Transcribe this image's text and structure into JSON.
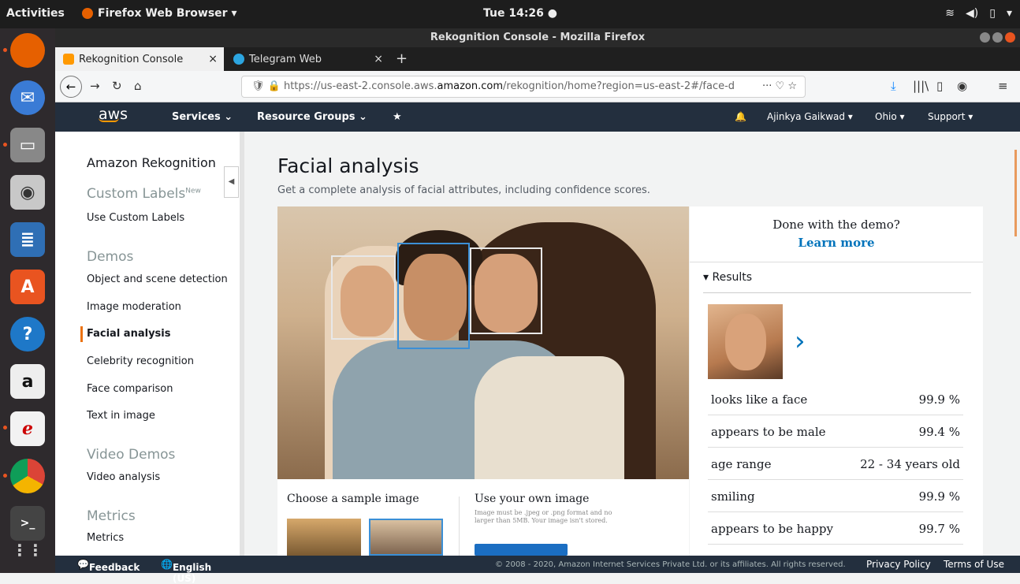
{
  "system": {
    "activities": "Activities",
    "app_menu": "Firefox Web Browser ▾",
    "clock": "Tue 14:26 ●"
  },
  "window": {
    "title": "Rekognition Console - Mozilla Firefox"
  },
  "tabs": [
    {
      "label": "Rekognition Console",
      "close": "×"
    },
    {
      "label": "Telegram Web",
      "close": "×"
    }
  ],
  "new_tab": "+",
  "url": {
    "prefix": "https://us-east-2.console.aws.",
    "domain": "amazon.com",
    "suffix": "/rekognition/home?region=us-east-2#/face-d"
  },
  "aws_nav": {
    "logo": "aws",
    "services": "Services ⌄",
    "resource_groups": "Resource Groups ⌄",
    "pin": "★",
    "bell": "🔔",
    "user": "Ajinkya Gaikwad ▾",
    "region": "Ohio ▾",
    "support": "Support ▾"
  },
  "sidebar": {
    "title": "Amazon Rekognition",
    "custom_labels": "Custom Labels",
    "new_badge": "New",
    "use_custom": "Use Custom Labels",
    "demos": "Demos",
    "items": [
      "Object and scene detection",
      "Image moderation",
      "Facial analysis",
      "Celebrity recognition",
      "Face comparison",
      "Text in image"
    ],
    "video_demos": "Video Demos",
    "video_analysis": "Video analysis",
    "metrics_h": "Metrics",
    "metrics": "Metrics"
  },
  "main": {
    "title": "Facial analysis",
    "subtitle": "Get a complete analysis of facial attributes, including confidence scores."
  },
  "results": {
    "done": "Done with the demo?",
    "learn": "Learn more",
    "header": "▾  Results",
    "next": "›",
    "rows": [
      {
        "label": "looks like a face",
        "value": "99.9 %"
      },
      {
        "label": "appears to be male",
        "value": "99.4 %"
      },
      {
        "label": "age range",
        "value": "22 - 34 years old"
      },
      {
        "label": "smiling",
        "value": "99.9 %"
      },
      {
        "label": "appears to be happy",
        "value": "99.7 %"
      }
    ]
  },
  "bottom": {
    "choose": "Choose a sample image",
    "own": "Use your own image",
    "note": "Image must be .jpeg or .png format and no larger than 5MB. Your image isn't stored."
  },
  "footer": {
    "feedback": "Feedback",
    "language": "English (US)",
    "copyright": "© 2008 - 2020, Amazon Internet Services Private Ltd. or its affiliates. All rights reserved.",
    "privacy": "Privacy Policy",
    "terms": "Terms of Use"
  },
  "colors": {
    "aws_nav": "#232f3e",
    "accent": "#ec7211",
    "link": "#0073bb",
    "selection": "#3b8fd6"
  }
}
